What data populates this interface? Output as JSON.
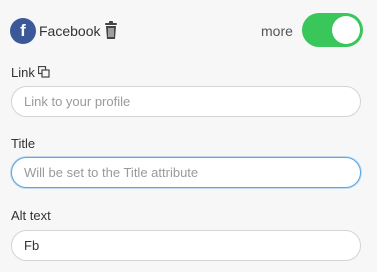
{
  "header": {
    "network_name": "Facebook",
    "network_icon": "facebook-icon",
    "delete_icon": "trash-icon",
    "more_label": "more",
    "toggle_on": true,
    "toggle_color": "#39c65b",
    "brand_color": "#3b5998"
  },
  "fields": {
    "link": {
      "label": "Link",
      "icon": "copy-icon",
      "value": "",
      "placeholder": "Link to your profile"
    },
    "title": {
      "label": "Title",
      "value": "",
      "placeholder": "Will be set to the Title attribute"
    },
    "alt": {
      "label": "Alt text",
      "value": "Fb",
      "placeholder": ""
    }
  }
}
